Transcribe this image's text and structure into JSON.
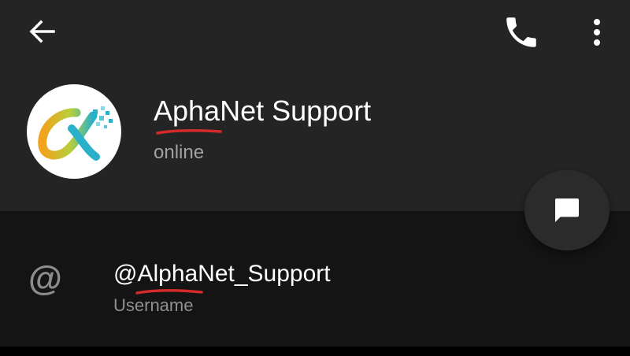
{
  "colors": {
    "header_bg": "#242424",
    "body_bg": "#141414",
    "text_primary": "#ffffff",
    "text_secondary": "#a2a2a2",
    "underline_annotation": "#d32a2a",
    "fab_bg": "#2b2b2b"
  },
  "top_bar": {
    "back_icon": "arrow-left-icon",
    "call_icon": "phone-icon",
    "menu_icon": "more-vertical-icon"
  },
  "profile": {
    "avatar_icon": "alphanet-logo",
    "name": "AphaNet Support",
    "status": "online"
  },
  "fab": {
    "icon": "message-icon"
  },
  "info": {
    "icon": "at-sign-icon",
    "at_symbol": "@",
    "username": "@AlphaNet_Support",
    "label": "Username"
  }
}
